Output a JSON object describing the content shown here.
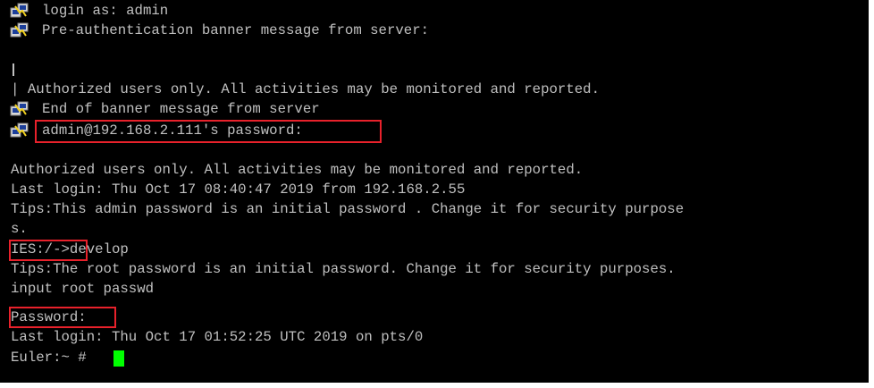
{
  "colors": {
    "background": "#000000",
    "text": "#c0c0c0",
    "highlight": "#e8212b",
    "cursor": "#00ff00"
  },
  "icons": [
    "putty-session-icon"
  ],
  "lines": {
    "l1": "login as: admin",
    "l2": "Pre-authentication banner message from server:",
    "l3": "| Authorized users only. All activities may be monitored and reported.",
    "l4": "End of banner message from server",
    "l5": "admin@192.168.2.111's password:",
    "l6": "Authorized users only. All activities may be monitored and reported.",
    "l7": "Last login: Thu Oct 17 08:40:47 2019 from 192.168.2.55",
    "l8": "Tips:This admin password is an initial password . Change it for security purpose",
    "l9": "s.",
    "l10_prompt": "IES:/->",
    "l10_cmd": "develop",
    "l11": "Tips:The root password is an initial password. Change it for security purposes.",
    "l12": "input root passwd",
    "l13": "Password:",
    "l14": "Last login: Thu Oct 17 01:52:25 UTC 2019 on pts/0",
    "l15": "Euler:~ #"
  }
}
